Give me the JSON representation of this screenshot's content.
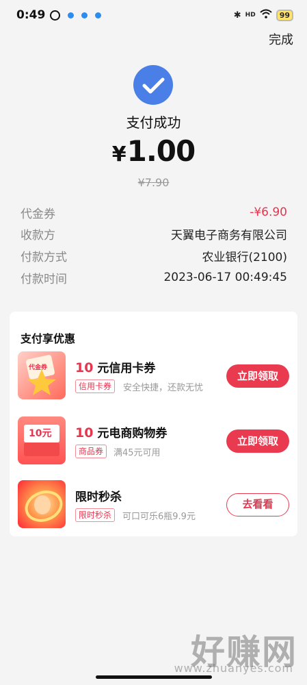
{
  "status_bar": {
    "time": "0:49",
    "battery": "99",
    "signal_label": "HD"
  },
  "header": {
    "done_label": "完成"
  },
  "result": {
    "title": "支付成功",
    "currency": "¥",
    "amount": "1.00",
    "original_price": "¥7.90",
    "accent_color": "#4a7fe8"
  },
  "details": [
    {
      "label": "代金券",
      "value": "-¥6.90"
    },
    {
      "label": "收款方",
      "value": "天翼电子商务有限公司"
    },
    {
      "label": "付款方式",
      "value": "农业银行(2100)"
    },
    {
      "label": "付款时间",
      "value": "2023-06-17 00:49:45"
    }
  ],
  "promotions": {
    "title": "支付享优惠",
    "items": [
      {
        "amount": "10",
        "title": "元信用卡券",
        "tag": "信用卡券",
        "desc": "安全快捷，还款无忧",
        "button": "立即领取",
        "thumb_text": "代金券"
      },
      {
        "amount": "10",
        "title": "元电商购物券",
        "tag": "商品券",
        "desc": "满45元可用",
        "button": "立即领取",
        "thumb_text": "10元"
      },
      {
        "amount": "",
        "title": "限时秒杀",
        "tag": "限时秒杀",
        "desc": "可口可乐6瓶9.9元",
        "button": "去看看",
        "thumb_text": ""
      }
    ]
  },
  "watermark": {
    "text": "好赚网",
    "sub": "www.zhuanyes.com"
  },
  "colors": {
    "brand_red": "#ea3a4f",
    "check_blue": "#4a7fe8"
  }
}
